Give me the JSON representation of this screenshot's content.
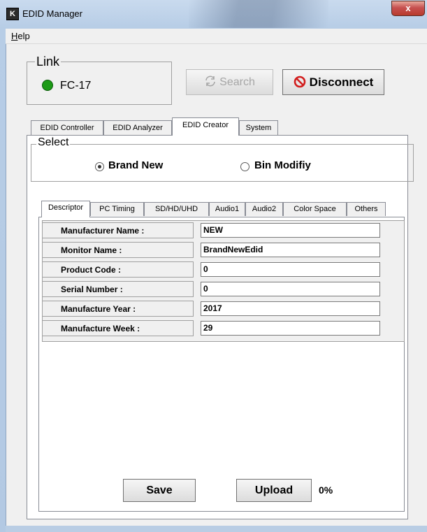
{
  "window": {
    "title": "EDID Manager",
    "icon_letter": "K",
    "close_glyph": "x"
  },
  "menu": {
    "items": [
      {
        "label": "Help"
      }
    ]
  },
  "link": {
    "group_title": "Link",
    "device": "FC-17",
    "status_color": "#1c9a16",
    "search_label": "Search",
    "disconnect_label": "Disconnect"
  },
  "tabs": [
    {
      "label": "EDID Controller",
      "active": false
    },
    {
      "label": "EDID Analyzer",
      "active": false
    },
    {
      "label": "EDID Creator",
      "active": true
    },
    {
      "label": "System",
      "active": false
    }
  ],
  "select": {
    "group_title": "Select",
    "options": [
      {
        "label": "Brand New",
        "selected": true
      },
      {
        "label": "Bin Modifiy",
        "selected": false
      }
    ]
  },
  "inner_tabs": [
    {
      "label": "Descriptor",
      "active": true
    },
    {
      "label": "PC Timing",
      "active": false
    },
    {
      "label": "SD/HD/UHD",
      "active": false
    },
    {
      "label": "Audio1",
      "active": false
    },
    {
      "label": "Audio2",
      "active": false
    },
    {
      "label": "Color Space",
      "active": false
    },
    {
      "label": "Others",
      "active": false
    }
  ],
  "descriptor": [
    {
      "label": "Manufacturer Name :",
      "value": "NEW"
    },
    {
      "label": "Monitor Name :",
      "value": "BrandNewEdid"
    },
    {
      "label": "Product Code :",
      "value": "0"
    },
    {
      "label": "Serial Number :",
      "value": "0"
    },
    {
      "label": "Manufacture Year :",
      "value": "2017"
    },
    {
      "label": "Manufacture Week :",
      "value": "29"
    }
  ],
  "actions": {
    "save_label": "Save",
    "upload_label": "Upload",
    "progress": "0%"
  }
}
